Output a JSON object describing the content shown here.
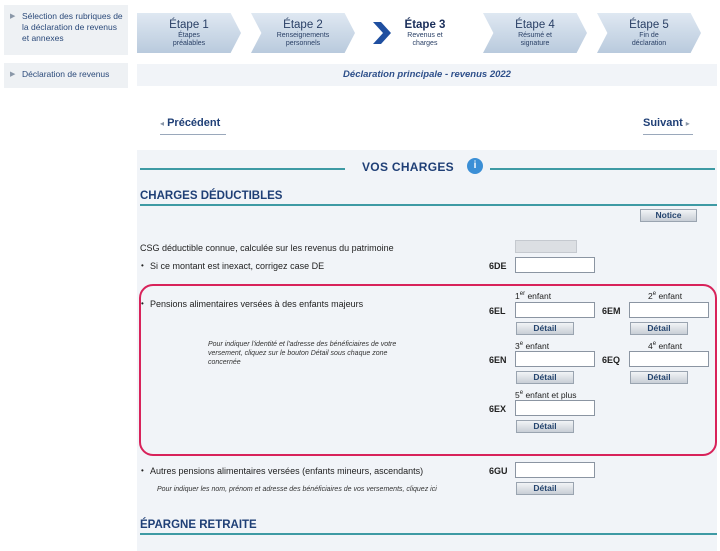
{
  "sidebar": {
    "items": [
      {
        "label": "Sélection des rubriques de la déclaration de revenus et annexes"
      },
      {
        "label": "Déclaration de revenus"
      }
    ]
  },
  "steps": [
    {
      "title": "Étape 1",
      "subtitle": "Étapes préalables"
    },
    {
      "title": "Étape 2",
      "subtitle": "Renseignements personnels"
    },
    {
      "title": "Étape 3",
      "subtitle": "Revenus et charges",
      "active": true
    },
    {
      "title": "Étape 4",
      "subtitle": "Résumé et signature"
    },
    {
      "title": "Étape 5",
      "subtitle": "Fin de déclaration"
    }
  ],
  "declaration_title": "Déclaration principale - revenus 2022",
  "nav": {
    "previous": "Précédent",
    "next": "Suivant"
  },
  "section_title": "VOS CHARGES",
  "charges_deductibles": {
    "heading": "CHARGES DÉDUCTIBLES",
    "notice_button": "Notice",
    "csg": {
      "label": "CSG déductible connue, calculée sur les revenus du patrimoine",
      "bullet": "Si ce montant est inexact, corrigez case DE",
      "code": "6DE"
    },
    "pensions_majeurs": {
      "bullet": "Pensions alimentaires versées à des enfants majeurs",
      "help": "Pour indiquer l'identité et l'adresse des bénéficiaires de votre versement, cliquez sur le bouton Détail sous chaque zone concernée",
      "detail_label": "Détail",
      "children": [
        {
          "num": "1",
          "sup": "er",
          "suffix": " enfant",
          "code": "6EL"
        },
        {
          "num": "2",
          "sup": "e",
          "suffix": " enfant",
          "code": "6EM"
        },
        {
          "num": "3",
          "sup": "e",
          "suffix": " enfant",
          "code": "6EN"
        },
        {
          "num": "4",
          "sup": "e",
          "suffix": " enfant",
          "code": "6EQ"
        },
        {
          "num": "5",
          "sup": "e",
          "suffix": " enfant et plus",
          "code": "6EX"
        }
      ]
    },
    "autres_pensions": {
      "bullet": "Autres pensions alimentaires versées (enfants mineurs, ascendants)",
      "code": "6GU",
      "help": "Pour indiquer les nom, prénom et adresse des bénéficiaires de vos versements, cliquez ici",
      "detail_label": "Détail"
    }
  },
  "epargne_heading": "ÉPARGNE RETRAITE"
}
